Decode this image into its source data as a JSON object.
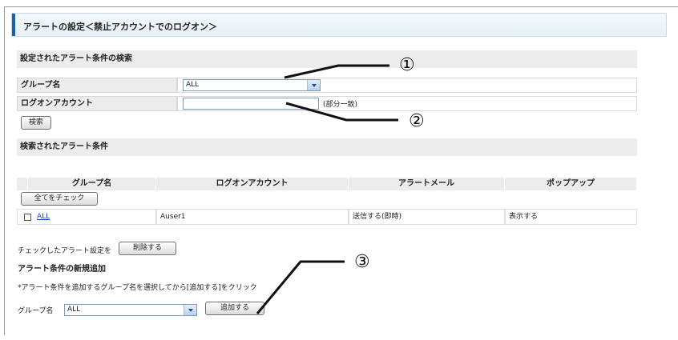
{
  "page_title": "アラートの設定＜禁止アカウントでのログオン＞",
  "search_section": {
    "heading": "設定されたアラート条件の検索",
    "group_label": "グループ名",
    "group_value": "ALL",
    "account_label": "ログオンアカウント",
    "account_value": "",
    "partial_match": "(部分一致)",
    "search_button": "検索"
  },
  "results_section": {
    "heading": "検索されたアラート条件",
    "columns": [
      "グループ名",
      "ログオンアカウント",
      "アラートメール",
      "ポップアップ"
    ],
    "check_all_button": "全てをチェック",
    "rows": [
      {
        "group": "ALL",
        "account": "Auser1",
        "mail": "送信する(即時)",
        "popup": "表示する"
      }
    ],
    "checked_label": "チェックしたアラート設定を",
    "delete_button": "削除する"
  },
  "add_section": {
    "heading": "アラート条件の新規追加",
    "instruction": "*アラート条件を追加するグループ名を選択してから[追加する]をクリック",
    "group_label": "グループ名",
    "group_value": "ALL",
    "add_button": "追加する"
  },
  "callouts": [
    "①",
    "②",
    "③"
  ],
  "colors": {
    "accent": "#1f5fa8",
    "link": "#1a3fbf",
    "header_bg": "#ececec"
  }
}
